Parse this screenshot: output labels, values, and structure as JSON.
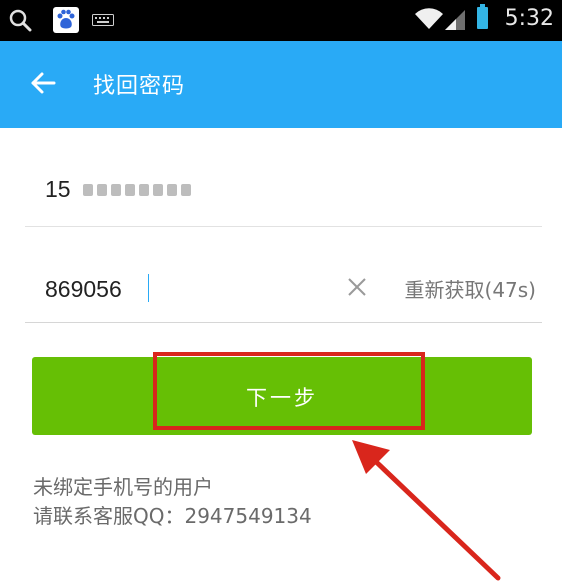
{
  "status_bar": {
    "time": "5:32",
    "icons": [
      "search-icon",
      "baidu-icon",
      "keyboard-icon",
      "wifi-icon",
      "signal-icon",
      "battery-icon"
    ]
  },
  "header": {
    "title": "找回密码",
    "back_icon": "back-arrow-icon"
  },
  "form": {
    "phone_value": "15",
    "code_value": "869056",
    "resend_label": "重新获取(47s)",
    "clear_icon": "clear-icon"
  },
  "next_button": {
    "label": "下一步"
  },
  "help": {
    "line1": "未绑定手机号的用户",
    "line2": "请联系客服QQ：2947549134"
  },
  "colors": {
    "status_bar": "#000000",
    "app_bar": "#29aaf6",
    "button": "#66bf05",
    "annotation": "#d9261c"
  }
}
